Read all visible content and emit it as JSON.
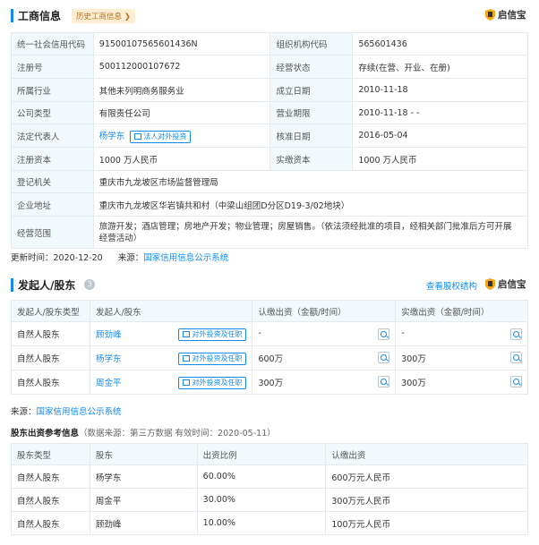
{
  "business_info": {
    "title": "工商信息",
    "history_tag": "历史工商信息 ❯",
    "brand": "启信宝",
    "rows": [
      {
        "l1": "统一社会信用代码",
        "v1": "91500107565601436N",
        "l2": "组织机构代码",
        "v2": "565601436"
      },
      {
        "l1": "注册号",
        "v1": "500112000107672",
        "l2": "经营状态",
        "v2": "存续(在营、开业、在册)"
      },
      {
        "l1": "所属行业",
        "v1": "其他未列明商务服务业",
        "l2": "成立日期",
        "v2": "2010-11-18"
      },
      {
        "l1": "公司类型",
        "v1": "有限责任公司",
        "l2": "营业期限",
        "v2": "2010-11-18 - -"
      },
      {
        "l1": "法定代表人",
        "v1": "杨学东",
        "v1_tag": "法人对外投资",
        "l2": "核准日期",
        "v2": "2016-05-04"
      },
      {
        "l1": "注册资本",
        "v1": "1000 万人民币",
        "l2": "实缴资本",
        "v2": "1000 万人民币"
      }
    ],
    "registration_authority_label": "登记机关",
    "registration_authority": "重庆市九龙坡区市场监督管理局",
    "address_label": "企业地址",
    "address": "重庆市九龙坡区华岩镇共和村（中梁山组团D分区D19-3/02地块）",
    "scope_label": "经营范围",
    "scope_line1": "旅游开发；酒店管理；房地产开发；物业管理；房屋销售。（依法须经批准的项目，经相关部门批准后方可开展",
    "scope_line2": "经营活动）",
    "update_label": "更新时间：",
    "update_date": "2020-12-20",
    "source_label": "来源：",
    "source": "国家信用信息公示系统"
  },
  "shareholders": {
    "title": "发起人/股东",
    "count": "3",
    "equity_link": "查看股权结构",
    "brand": "启信宝",
    "headers": [
      "发起人/股东类型",
      "发起人/股东",
      "认缴出资（金额/时间）",
      "实缴出资（金额/时间）"
    ],
    "rows": [
      {
        "type": "自然人股东",
        "name": "顾劲峰",
        "tag": "对外投资及任职",
        "subscribed": "-",
        "paid": "-"
      },
      {
        "type": "自然人股东",
        "name": "杨学东",
        "tag": "对外投资及任职",
        "subscribed": "600万",
        "paid": "300万"
      },
      {
        "type": "自然人股东",
        "name": "周金平",
        "tag": "对外投资及任职",
        "subscribed": "300万",
        "paid": "300万"
      }
    ],
    "source_label": "来源：",
    "source": "国家信用信息公示系统"
  },
  "contribution_ref": {
    "title": "股东出资参考信息",
    "note": "（数据来源：第三方数据 有效时间：2020-05-11）",
    "headers": [
      "股东类型",
      "股东",
      "出资比例",
      "认缴出资"
    ],
    "rows": [
      {
        "type": "自然人股东",
        "name": "杨学东",
        "ratio": "60.00%",
        "amount": "600万元人民币"
      },
      {
        "type": "自然人股东",
        "name": "周金平",
        "ratio": "30.00%",
        "amount": "300万元人民币"
      },
      {
        "type": "自然人股东",
        "name": "顾劲峰",
        "ratio": "10.00%",
        "amount": "100万元人民币"
      }
    ]
  },
  "colors": {
    "accent": "#128bed",
    "label_bg": "#f2f9fc",
    "tag_bg": "#fdeed3",
    "border": "#e4eaf0"
  }
}
